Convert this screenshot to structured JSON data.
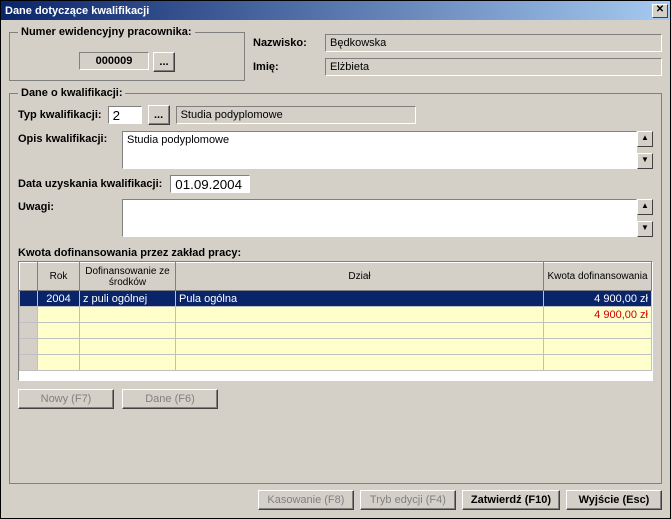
{
  "title": "Dane dotyczące kwalifikacji",
  "top": {
    "emp_legend": "Numer ewidencyjny pracownika:",
    "emp_num": "000009",
    "ellipsis": "...",
    "surname_label": "Nazwisko:",
    "surname": "Będkowska",
    "firstname_label": "Imię:",
    "firstname": "Elżbieta"
  },
  "qual": {
    "legend": "Dane o kwalifikacji:",
    "type_label": "Typ kwalifikacji:",
    "type_code": "2",
    "type_name": "Studia podyplomowe",
    "desc_label": "Opis kwalifikacji:",
    "desc": "Studia podyplomowe",
    "date_label": "Data uzyskania kwalifikacji:",
    "date": "01.09.2004",
    "notes_label": "Uwagi:",
    "notes": ""
  },
  "funding": {
    "label": "Kwota dofinansowania przez zakład pracy:",
    "headers": {
      "year": "Rok",
      "source": "Dofinansowanie ze środków",
      "dept": "Dział",
      "amount": "Kwota dofinansowania"
    },
    "row": {
      "year": "2004",
      "source": "z puli ogólnej",
      "dept": "Pula ogólna",
      "amount": "4 900,00 zł"
    },
    "total": "4 900,00 zł"
  },
  "buttons": {
    "new": "Nowy (F7)",
    "data": "Dane (F6)",
    "delete": "Kasowanie (F8)",
    "edit": "Tryb edycji (F4)",
    "confirm": "Zatwierdź (F10)",
    "exit": "Wyjście (Esc)"
  },
  "icons": {
    "up": "▲",
    "down": "▼",
    "close": "✕"
  }
}
